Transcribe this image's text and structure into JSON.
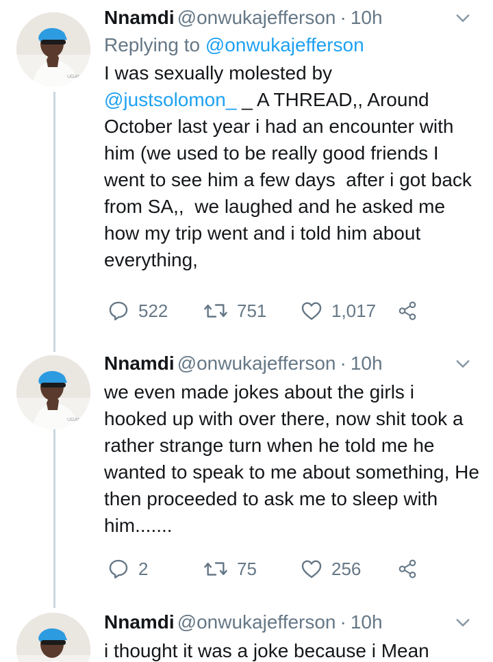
{
  "tweets": [
    {
      "name": "Nnamdi",
      "handle": "@onwukajefferson",
      "separator": "·",
      "time": "10h",
      "replying_prefix": "Replying to",
      "replying_to": "@onwukajefferson",
      "text_before_mention": "I was sexually molested by\n",
      "mention": "@justsolomon_",
      "text_after_mention": " _ A THREAD,, Around October last year i had an encounter with him (we used to be really good friends I went to see him a few days  after i got back from SA,,  we laughed and he asked me how my trip went and i told him about everything,",
      "replies": "522",
      "retweets": "751",
      "likes": "1,017"
    },
    {
      "name": "Nnamdi",
      "handle": "@onwukajefferson",
      "separator": "·",
      "time": "10h",
      "text": "we even made jokes about the girls i hooked up with over there, now shit took a rather strange turn when he told me he wanted to speak to me about something, He then proceeded to ask me to sleep with him.......",
      "replies": "2",
      "retweets": "75",
      "likes": "256"
    },
    {
      "name": "Nnamdi",
      "handle": "@onwukajefferson",
      "separator": "·",
      "time": "10h",
      "text": "i thought it was a joke because i Mean"
    }
  ],
  "icons": {
    "reply": "reply-icon",
    "retweet": "retweet-icon",
    "like": "heart-icon",
    "share": "share-icon",
    "more": "chevron-down-icon"
  },
  "colors": {
    "text": "#14171a",
    "secondary": "#657786",
    "link": "#1da1f2",
    "thread_line": "#ccd6dd"
  }
}
